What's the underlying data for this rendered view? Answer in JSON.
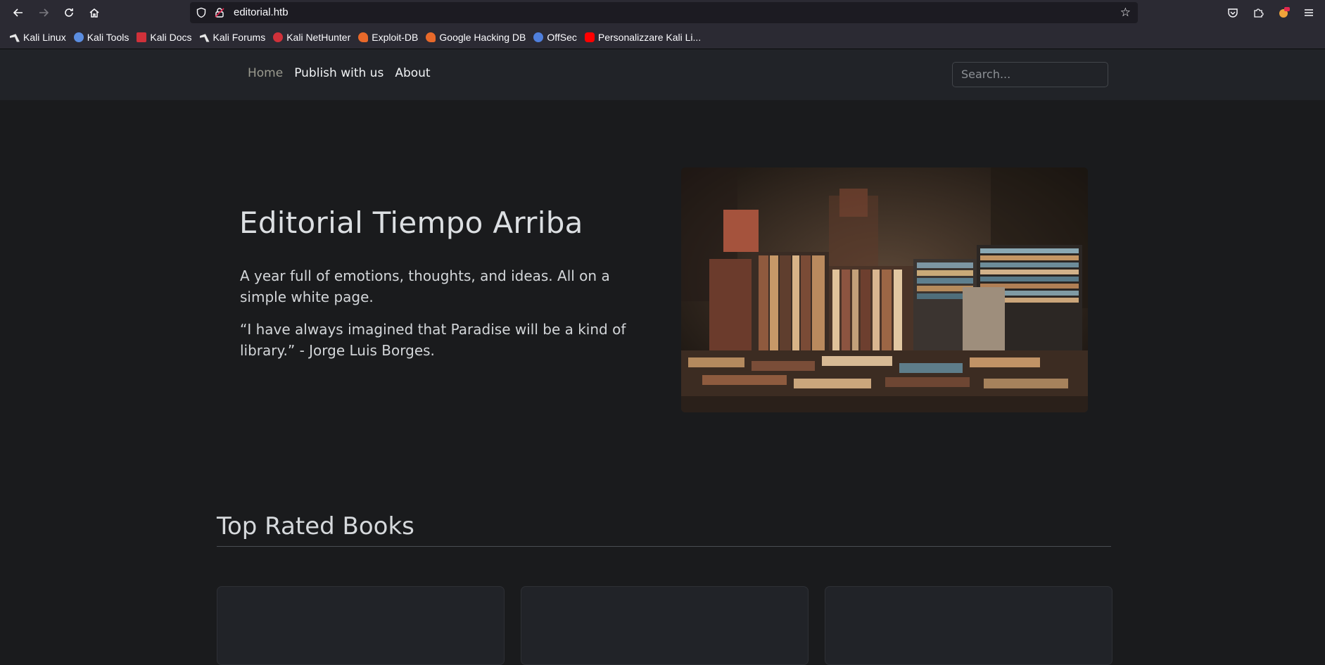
{
  "browser": {
    "url": "editorial.htb",
    "bookmarks": [
      {
        "label": "Kali Linux",
        "icon": "kali-dragon-icon",
        "color": "#e6e6e6"
      },
      {
        "label": "Kali Tools",
        "icon": "kali-tools-icon",
        "color": "#5b8de0"
      },
      {
        "label": "Kali Docs",
        "icon": "kali-docs-icon",
        "color": "#d0313a"
      },
      {
        "label": "Kali Forums",
        "icon": "kali-forums-icon",
        "color": "#e6e6e6"
      },
      {
        "label": "Kali NetHunter",
        "icon": "nethunter-icon",
        "color": "#d0313a"
      },
      {
        "label": "Exploit-DB",
        "icon": "exploit-db-icon",
        "color": "#e8692a"
      },
      {
        "label": "Google Hacking DB",
        "icon": "ghdb-icon",
        "color": "#e8692a"
      },
      {
        "label": "OffSec",
        "icon": "offsec-icon",
        "color": "#4f7fdc"
      },
      {
        "label": "Personalizzare Kali Li...",
        "icon": "youtube-icon",
        "color": "#ff0000"
      }
    ]
  },
  "nav": {
    "links": [
      {
        "label": "Home",
        "active": true
      },
      {
        "label": "Publish with us",
        "active": false
      },
      {
        "label": "About",
        "active": false
      }
    ],
    "search_placeholder": "Search..."
  },
  "hero": {
    "title": "Editorial Tiempo Arriba",
    "paragraph1": "A year full of emotions, thoughts, and ideas. All on a simple white page.",
    "paragraph2": "“I have always imagined that Paradise will be a kind of library.” - Jorge Luis Borges."
  },
  "section": {
    "title": "Top Rated Books"
  },
  "colors": {
    "page_bg": "#1a1b1d",
    "navbar_bg": "#212328",
    "chrome_bg": "#2b2a33"
  }
}
